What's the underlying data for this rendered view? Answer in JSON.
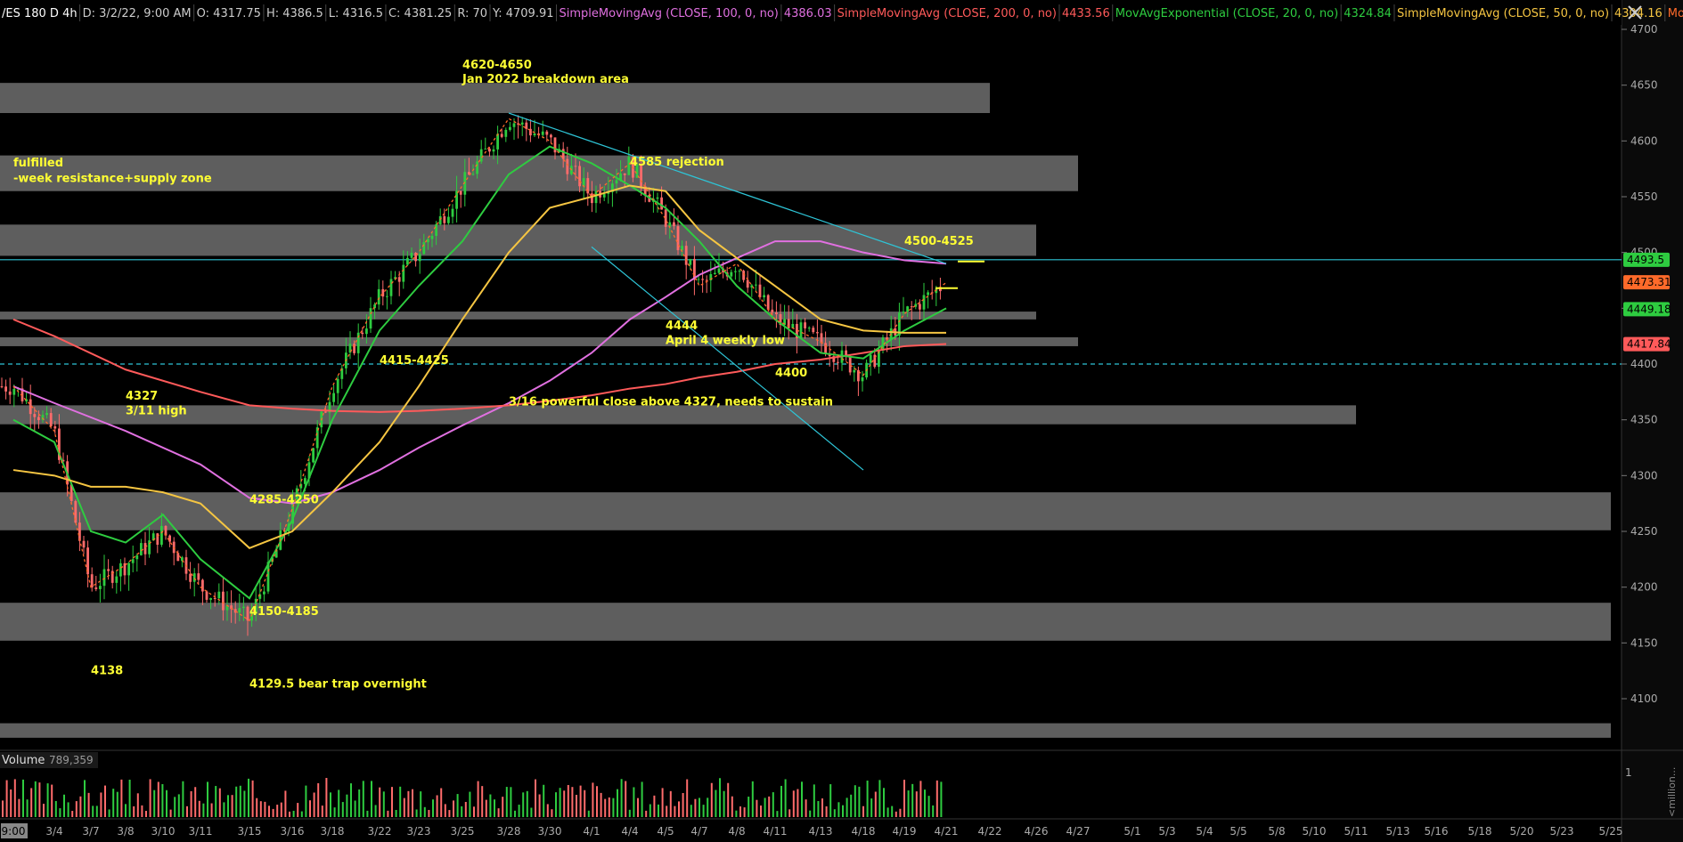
{
  "header": {
    "symbol": "/ES 180 D 4h",
    "date": "D: 3/2/22, 9:00 AM",
    "open": "O: 4317.75",
    "high": "H: 4386.5",
    "low": "L: 4316.5",
    "close": "C: 4381.25",
    "range": "R: 70",
    "y": "Y: 4709.91",
    "studies": [
      {
        "label": "SimpleMovingAvg (CLOSE, 100, 0, no)",
        "value": "4386.03",
        "color": "#e070e0"
      },
      {
        "label": "SimpleMovingAvg (CLOSE, 200, 0, no)",
        "value": "4433.56",
        "color": "#ff5a5a"
      },
      {
        "label": "MovAvgExponential (CLOSE, 20, 0, no)",
        "value": "4324.84",
        "color": "#2ecc40"
      },
      {
        "label": "SimpleMovingAvg (CLOSE, 50, 0, no)",
        "value": "4304.16",
        "color": "#f5c542"
      },
      {
        "label": "MovAvg...",
        "value": "",
        "color": "#ff6a2a"
      }
    ]
  },
  "chart_data": {
    "type": "candlestick",
    "ylim": [
      4060,
      4710
    ],
    "yticks": [
      4700,
      4650,
      4600,
      4550,
      4500,
      4450,
      4400,
      4350,
      4300,
      4250,
      4200,
      4150,
      4100
    ],
    "xticks": [
      "9:00",
      "3/4",
      "3/7",
      "3/8",
      "3/10",
      "3/11",
      "3/15",
      "3/16",
      "3/18",
      "3/22",
      "3/23",
      "3/25",
      "3/28",
      "3/30",
      "4/1",
      "4/4",
      "4/5",
      "4/7",
      "4/8",
      "4/11",
      "4/13",
      "4/18",
      "4/19",
      "4/21",
      "4/22",
      "4/26",
      "4/27",
      "5/1",
      "5/3",
      "5/4",
      "5/5",
      "5/8",
      "5/10",
      "5/11",
      "5/13",
      "5/16",
      "5/18",
      "5/20",
      "5/23",
      "5/25"
    ],
    "price_badges": [
      {
        "value": "4493.5",
        "color": "#2ecc40"
      },
      {
        "value": "4473.31",
        "color": "#ff6a2a"
      },
      {
        "value": "4449.18",
        "color": "#2ecc40"
      },
      {
        "value": "4417.84",
        "color": "#ff5a5a"
      }
    ],
    "horizontal_lines": [
      {
        "price": 4493.5,
        "style": "solid",
        "color": "#2ec4d6"
      },
      {
        "price": 4400,
        "style": "dashed",
        "color": "#2ec4d6"
      }
    ],
    "zones": [
      {
        "low": 4625,
        "high": 4652,
        "end": "4/22"
      },
      {
        "low": 4555,
        "high": 4587,
        "end": "4/27"
      },
      {
        "low": 4497,
        "high": 4525,
        "end": "4/26"
      },
      {
        "low": 4440,
        "high": 4447,
        "end": "4/26"
      },
      {
        "low": 4416,
        "high": 4424,
        "end": "4/27"
      },
      {
        "low": 4346,
        "high": 4363,
        "end": "5/11"
      },
      {
        "low": 4251,
        "high": 4285,
        "end": "5/25"
      },
      {
        "low": 4152,
        "high": 4186,
        "end": "5/25"
      },
      {
        "low": 4065,
        "high": 4078,
        "end": "5/25"
      }
    ],
    "annotations": [
      {
        "text": "4620-4650",
        "at": "3/25",
        "price": 4665
      },
      {
        "text": "Jan 2022 breakdown area",
        "at": "3/25",
        "price": 4652
      },
      {
        "text": "fulfilled",
        "at": "9:00",
        "price": 4577
      },
      {
        "text": "-week resistance+supply zone",
        "at": "9:00",
        "price": 4563
      },
      {
        "text": "4585 rejection",
        "at": "4/4",
        "price": 4578
      },
      {
        "text": "4500-4525",
        "at": "4/19",
        "price": 4507
      },
      {
        "text": "4444",
        "at": "4/5",
        "price": 4431
      },
      {
        "text": "April 4 weekly low",
        "at": "4/5",
        "price": 4418
      },
      {
        "text": "4415-4425",
        "at": "3/22",
        "price": 4400
      },
      {
        "text": "4400",
        "at": "4/11",
        "price": 4389
      },
      {
        "text": "4327",
        "at": "3/8",
        "price": 4368
      },
      {
        "text": "3/11 high",
        "at": "3/8",
        "price": 4355
      },
      {
        "text": "3/16 powerful close above 4327, needs to sustain",
        "at": "3/28",
        "price": 4363
      },
      {
        "text": "4285-4250",
        "at": "3/15",
        "price": 4275
      },
      {
        "text": "4150-4185",
        "at": "3/15",
        "price": 4175
      },
      {
        "text": "4138",
        "at": "3/7",
        "price": 4122
      },
      {
        "text": "4129.5 bear trap overnight",
        "at": "3/15",
        "price": 4110
      }
    ],
    "trendlines": [
      {
        "from": {
          "x": "3/28",
          "price": 4625
        },
        "to": {
          "x": "4/21",
          "price": 4490
        }
      },
      {
        "from": {
          "x": "4/1",
          "price": 4505
        },
        "to": {
          "x": "4/18",
          "price": 4305
        }
      }
    ],
    "series": [
      {
        "name": "SimpleMovingAvg (CLOSE, 100, 0, no)",
        "color": "#e070e0",
        "points": [
          [
            "9:00",
            4380
          ],
          [
            "3/4",
            4365
          ],
          [
            "3/8",
            4340
          ],
          [
            "3/11",
            4310
          ],
          [
            "3/15",
            4280
          ],
          [
            "3/16",
            4275
          ],
          [
            "3/18",
            4285
          ],
          [
            "3/22",
            4305
          ],
          [
            "3/23",
            4325
          ],
          [
            "3/25",
            4345
          ],
          [
            "3/28",
            4365
          ],
          [
            "3/30",
            4385
          ],
          [
            "4/1",
            4410
          ],
          [
            "4/4",
            4440
          ],
          [
            "4/5",
            4460
          ],
          [
            "4/7",
            4480
          ],
          [
            "4/8",
            4495
          ],
          [
            "4/11",
            4510
          ],
          [
            "4/13",
            4510
          ],
          [
            "4/18",
            4500
          ],
          [
            "4/19",
            4493
          ],
          [
            "4/21",
            4490
          ]
        ]
      },
      {
        "name": "SimpleMovingAvg (CLOSE, 200, 0, no)",
        "color": "#ff5a5a",
        "points": [
          [
            "9:00",
            4440
          ],
          [
            "3/4",
            4425
          ],
          [
            "3/8",
            4395
          ],
          [
            "3/11",
            4375
          ],
          [
            "3/15",
            4363
          ],
          [
            "3/16",
            4360
          ],
          [
            "3/18",
            4358
          ],
          [
            "3/22",
            4357
          ],
          [
            "3/23",
            4358
          ],
          [
            "3/25",
            4360
          ],
          [
            "3/28",
            4363
          ],
          [
            "3/30",
            4367
          ],
          [
            "4/1",
            4372
          ],
          [
            "4/4",
            4378
          ],
          [
            "4/5",
            4382
          ],
          [
            "4/7",
            4388
          ],
          [
            "4/8",
            4393
          ],
          [
            "4/11",
            4400
          ],
          [
            "4/13",
            4404
          ],
          [
            "4/18",
            4410
          ],
          [
            "4/19",
            4416
          ],
          [
            "4/21",
            4418
          ]
        ]
      },
      {
        "name": "MovAvgExponential (CLOSE, 20, 0, no)",
        "color": "#2ecc40",
        "points": [
          [
            "9:00",
            4350
          ],
          [
            "3/4",
            4330
          ],
          [
            "3/7",
            4250
          ],
          [
            "3/8",
            4240
          ],
          [
            "3/10",
            4265
          ],
          [
            "3/11",
            4225
          ],
          [
            "3/15",
            4190
          ],
          [
            "3/16",
            4260
          ],
          [
            "3/18",
            4350
          ],
          [
            "3/22",
            4430
          ],
          [
            "3/23",
            4470
          ],
          [
            "3/25",
            4510
          ],
          [
            "3/28",
            4570
          ],
          [
            "3/30",
            4595
          ],
          [
            "4/1",
            4580
          ],
          [
            "4/4",
            4560
          ],
          [
            "4/5",
            4540
          ],
          [
            "4/7",
            4510
          ],
          [
            "4/8",
            4470
          ],
          [
            "4/11",
            4440
          ],
          [
            "4/13",
            4410
          ],
          [
            "4/18",
            4405
          ],
          [
            "4/19",
            4430
          ],
          [
            "4/21",
            4450
          ]
        ]
      },
      {
        "name": "SimpleMovingAvg (CLOSE, 50, 0, no)",
        "color": "#f5c542",
        "points": [
          [
            "9:00",
            4305
          ],
          [
            "3/4",
            4300
          ],
          [
            "3/7",
            4290
          ],
          [
            "3/8",
            4290
          ],
          [
            "3/10",
            4285
          ],
          [
            "3/11",
            4275
          ],
          [
            "3/15",
            4235
          ],
          [
            "3/16",
            4250
          ],
          [
            "3/18",
            4285
          ],
          [
            "3/22",
            4330
          ],
          [
            "3/23",
            4380
          ],
          [
            "3/25",
            4440
          ],
          [
            "3/28",
            4500
          ],
          [
            "3/30",
            4540
          ],
          [
            "4/1",
            4550
          ],
          [
            "4/4",
            4560
          ],
          [
            "4/5",
            4555
          ],
          [
            "4/7",
            4520
          ],
          [
            "4/8",
            4495
          ],
          [
            "4/11",
            4470
          ],
          [
            "4/13",
            4440
          ],
          [
            "4/18",
            4430
          ],
          [
            "4/19",
            4428
          ],
          [
            "4/21",
            4428
          ]
        ]
      },
      {
        "name": "MovAvg...",
        "color": "#ff6a2a",
        "points": [
          [
            "9:00",
            4380
          ],
          [
            "3/4",
            4340
          ],
          [
            "3/7",
            4200
          ],
          [
            "3/8",
            4220
          ],
          [
            "3/10",
            4250
          ],
          [
            "3/11",
            4200
          ],
          [
            "3/15",
            4170
          ],
          [
            "3/16",
            4270
          ],
          [
            "3/18",
            4380
          ],
          [
            "3/22",
            4460
          ],
          [
            "3/23",
            4500
          ],
          [
            "3/25",
            4560
          ],
          [
            "3/28",
            4620
          ],
          [
            "3/30",
            4600
          ],
          [
            "4/1",
            4550
          ],
          [
            "4/4",
            4580
          ],
          [
            "4/5",
            4530
          ],
          [
            "4/7",
            4470
          ],
          [
            "4/8",
            4490
          ],
          [
            "4/11",
            4440
          ],
          [
            "4/13",
            4420
          ],
          [
            "4/18",
            4390
          ],
          [
            "4/19",
            4445
          ],
          [
            "4/21",
            4473
          ]
        ]
      }
    ],
    "volume": {
      "label": "Volume",
      "value": "789,359",
      "axis_tick": "1",
      "axis_unit": "<million..."
    }
  }
}
